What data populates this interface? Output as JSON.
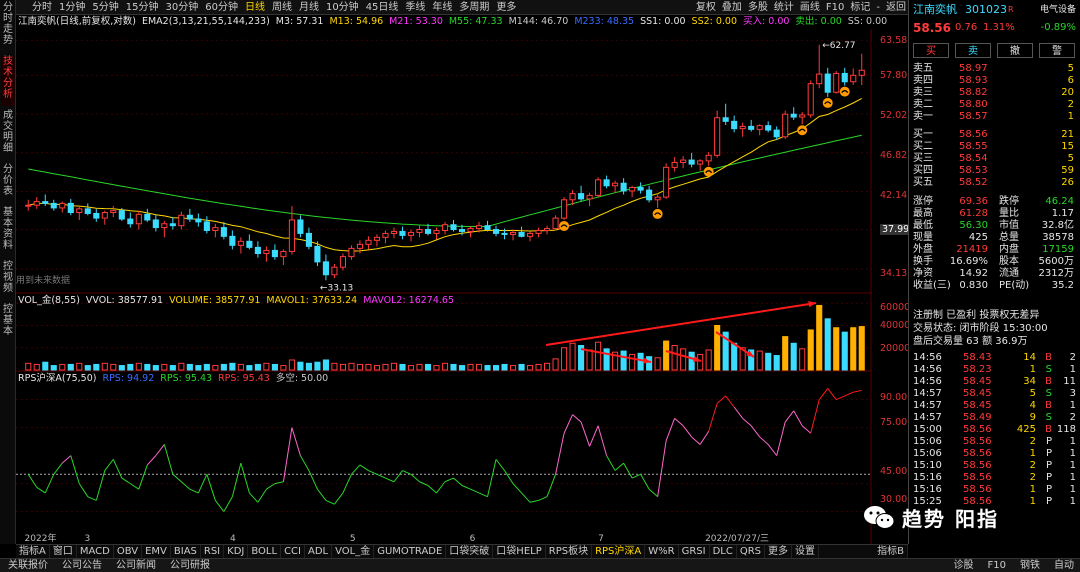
{
  "left_tabs": [
    "分时走势",
    "技术分析",
    "成交明细",
    "分价表",
    "基本资料",
    "控视频",
    "控基本"
  ],
  "period_tabs": [
    "分时",
    "1分钟",
    "5分钟",
    "15分钟",
    "30分钟",
    "60分钟",
    "日线",
    "周线",
    "月线",
    "10分钟",
    "45日线",
    "季线",
    "年线",
    "多周期",
    "更多"
  ],
  "period_selected": 6,
  "top_right": [
    "复权",
    "叠加",
    "多股",
    "统计",
    "画线",
    "F10",
    "标记",
    "-",
    "返回"
  ],
  "title_line": {
    "name": "江南奕帆(日线,前复权,对数)",
    "ema": "EMA2(3,13,21,55,144,233)",
    "items": [
      {
        "text": "M3: 57.31",
        "color": "#e6e6e6"
      },
      {
        "text": "M13: 54.96",
        "color": "#ffd800"
      },
      {
        "text": "M21: 53.30",
        "color": "#ff38ff"
      },
      {
        "text": "M55: 47.33",
        "color": "#2ad62a"
      },
      {
        "text": "M144: 46.70",
        "color": "#c8c8c8"
      },
      {
        "text": "M233: 48.35",
        "color": "#3b6bff"
      },
      {
        "text": "SS1: 0.00",
        "color": "#e6e6e6"
      },
      {
        "text": "SS2: 0.00",
        "color": "#ffd800"
      },
      {
        "text": "买入: 0.00",
        "color": "#ff38ff"
      },
      {
        "text": "卖出: 0.00",
        "color": "#2ad62a"
      },
      {
        "text": "SS: 0.00",
        "color": "#c8c8c8"
      }
    ]
  },
  "price_axis": [
    "63.58",
    "57.80",
    "52.02",
    "46.82",
    "42.14",
    "37.99",
    "34.13"
  ],
  "hi_label": "62.77",
  "lo_label": "33.13",
  "note_label": "用到未来数据",
  "vol_line": {
    "name": "VOL_金(8,55)",
    "items": [
      {
        "text": "VVOL: 38577.91",
        "color": "#e6e6e6"
      },
      {
        "text": "VOLUME: 38577.91",
        "color": "#ffd800"
      },
      {
        "text": "MAVOL1: 37633.24",
        "color": "#ffd800"
      },
      {
        "text": "MAVOL2: 16274.65",
        "color": "#ff38ff"
      }
    ]
  },
  "vol_axis": [
    "60000",
    "40000",
    "20000"
  ],
  "rps_line": {
    "name": "RPS沪深A(75,50)",
    "items": [
      {
        "text": "RPS: 94.92",
        "color": "#3b6bff"
      },
      {
        "text": "RPS: 95.43",
        "color": "#2ad62a"
      },
      {
        "text": "RPS: 95.43",
        "color": "#ff3b3b"
      },
      {
        "text": "多空: 50.00",
        "color": "#c8c8c8"
      }
    ]
  },
  "rps_axis": [
    "90.00",
    "75.00",
    "45.00",
    "30.00"
  ],
  "date_labels": [
    {
      "text": "2022年",
      "pos": 0.01
    },
    {
      "text": "3",
      "pos": 0.08
    },
    {
      "text": "4",
      "pos": 0.25
    },
    {
      "text": "5",
      "pos": 0.39
    },
    {
      "text": "6",
      "pos": 0.53
    },
    {
      "text": "7",
      "pos": 0.68
    },
    {
      "text": "2022/07/27/三",
      "pos": 0.805
    }
  ],
  "bottom_tabs": [
    "指标A",
    "窗口",
    "MACD",
    "OBV",
    "EMV",
    "BIAS",
    "RSI",
    "KDJ",
    "BOLL",
    "CCI",
    "ADL",
    "VOL_金",
    "GUMOTRADE",
    "口袋突破",
    "口袋HELP",
    "RPS板块",
    "RPS沪深A",
    "W%R",
    "GRSI",
    "DLC",
    "QRS",
    "更多",
    "设置"
  ],
  "bottom_selected": 16,
  "bottom_right": "指标B",
  "status_items": [
    "关联报价",
    "公司公告",
    "公司新闻",
    "公司研报"
  ],
  "status_right": [
    "诊股",
    "F10",
    "钢铁",
    "自动"
  ],
  "stock": {
    "name": "江南奕帆",
    "code": "301023",
    "sector": "电气设备",
    "price": "58.56",
    "change": "0.76",
    "pct": "1.31%",
    "weibi": "-0.89%"
  },
  "trade_buttons": [
    "买",
    "卖",
    "撤",
    "警"
  ],
  "asks": [
    {
      "label": "卖五",
      "price": "58.97",
      "vol": "5"
    },
    {
      "label": "卖四",
      "price": "58.93",
      "vol": "6"
    },
    {
      "label": "卖三",
      "price": "58.82",
      "vol": "20"
    },
    {
      "label": "卖二",
      "price": "58.80",
      "vol": "2"
    },
    {
      "label": "卖一",
      "price": "58.57",
      "vol": "1"
    }
  ],
  "bids": [
    {
      "label": "买一",
      "price": "58.56",
      "vol": "21"
    },
    {
      "label": "买二",
      "price": "58.55",
      "vol": "15"
    },
    {
      "label": "买三",
      "price": "58.54",
      "vol": "5"
    },
    {
      "label": "买四",
      "price": "58.53",
      "vol": "59"
    },
    {
      "label": "买五",
      "price": "58.52",
      "vol": "26"
    }
  ],
  "stats": [
    [
      "涨停",
      "69.36",
      "跌停",
      "46.24"
    ],
    [
      "最高",
      "61.28",
      "量比",
      "1.17"
    ],
    [
      "最低",
      "56.30",
      "市值",
      "32.8亿"
    ],
    [
      "现量",
      "425",
      "总量",
      "38578"
    ],
    [
      "外盘",
      "21419",
      "内盘",
      "17159"
    ],
    [
      "换手",
      "16.69%",
      "股本",
      "5600万"
    ],
    [
      "净资",
      "14.92",
      "流通",
      "2312万"
    ],
    [
      "收益(三)",
      "0.830",
      "PE(动)",
      "35.2"
    ]
  ],
  "info_lines": [
    "注册制 已盈利 投票权无差异",
    "交易状态: 闭市阶段 15:30:00",
    "盘后交易量 63 额 36.9万"
  ],
  "ticks": [
    [
      "14:56",
      "58.43",
      "14",
      "B",
      "2"
    ],
    [
      "14:56",
      "58.23",
      "1",
      "S",
      "1"
    ],
    [
      "14:56",
      "58.45",
      "34",
      "B",
      "11"
    ],
    [
      "14:57",
      "58.45",
      "5",
      "S",
      "3"
    ],
    [
      "14:57",
      "58.45",
      "4",
      "B",
      "1"
    ],
    [
      "14:57",
      "58.49",
      "9",
      "S",
      "2"
    ],
    [
      "15:00",
      "58.56",
      "425",
      "B",
      "118"
    ],
    [
      "15:06",
      "58.56",
      "2",
      "P",
      "1"
    ],
    [
      "15:06",
      "58.56",
      "1",
      "P",
      "1"
    ],
    [
      "15:10",
      "58.56",
      "2",
      "P",
      "1"
    ],
    [
      "15:16",
      "58.56",
      "2",
      "P",
      "1"
    ],
    [
      "15:16",
      "58.56",
      "1",
      "P",
      "1"
    ],
    [
      "15:25",
      "58.56",
      "1",
      "P",
      "1"
    ]
  ],
  "watermark": "趋势 阳指",
  "chart_data": {
    "type": "candlestick",
    "candles": [
      [
        40.5,
        41.2,
        40.0,
        40.6
      ],
      [
        40.6,
        41.5,
        40.2,
        41.0
      ],
      [
        41.0,
        41.8,
        40.5,
        40.8
      ],
      [
        40.8,
        41.2,
        40.0,
        40.3
      ],
      [
        40.3,
        41.0,
        39.8,
        40.8
      ],
      [
        40.8,
        41.3,
        39.5,
        39.8
      ],
      [
        39.8,
        40.5,
        39.0,
        40.2
      ],
      [
        40.2,
        40.8,
        39.5,
        39.7
      ],
      [
        39.7,
        40.2,
        38.8,
        39.2
      ],
      [
        39.2,
        40.0,
        38.5,
        39.8
      ],
      [
        39.8,
        40.5,
        39.3,
        40.0
      ],
      [
        40.0,
        40.3,
        38.9,
        39.1
      ],
      [
        39.1,
        39.8,
        38.2,
        38.6
      ],
      [
        38.6,
        40.0,
        38.0,
        39.6
      ],
      [
        39.6,
        40.2,
        38.8,
        39.0
      ],
      [
        39.0,
        39.6,
        37.8,
        38.2
      ],
      [
        38.2,
        38.9,
        37.2,
        38.6
      ],
      [
        38.6,
        39.3,
        38.0,
        38.4
      ],
      [
        38.4,
        39.9,
        38.0,
        39.5
      ],
      [
        39.5,
        40.2,
        38.8,
        39.1
      ],
      [
        39.1,
        39.7,
        38.3,
        38.8
      ],
      [
        38.8,
        39.4,
        37.6,
        37.9
      ],
      [
        37.9,
        38.6,
        37.2,
        38.2
      ],
      [
        38.2,
        38.8,
        37.0,
        37.3
      ],
      [
        37.3,
        37.9,
        36.0,
        36.4
      ],
      [
        36.4,
        37.2,
        35.6,
        36.8
      ],
      [
        36.8,
        37.5,
        36.0,
        36.2
      ],
      [
        36.2,
        36.8,
        35.2,
        35.6
      ],
      [
        35.6,
        36.3,
        34.8,
        35.9
      ],
      [
        35.9,
        36.5,
        35.0,
        35.3
      ],
      [
        35.3,
        36.0,
        34.5,
        35.8
      ],
      [
        35.8,
        40.5,
        35.5,
        39.0
      ],
      [
        39.0,
        39.5,
        37.2,
        37.6
      ],
      [
        37.6,
        38.2,
        36.0,
        36.3
      ],
      [
        36.3,
        36.8,
        34.4,
        34.8
      ],
      [
        34.8,
        35.5,
        33.1,
        33.6
      ],
      [
        33.6,
        34.6,
        33.3,
        34.3
      ],
      [
        34.3,
        35.6,
        34.0,
        35.3
      ],
      [
        35.3,
        36.4,
        35.0,
        36.1
      ],
      [
        36.1,
        36.9,
        35.6,
        36.5
      ],
      [
        36.5,
        37.3,
        36.0,
        36.9
      ],
      [
        36.9,
        37.5,
        36.3,
        37.2
      ],
      [
        37.2,
        37.9,
        36.6,
        37.6
      ],
      [
        37.6,
        38.2,
        37.1,
        37.8
      ],
      [
        37.8,
        38.3,
        37.0,
        37.4
      ],
      [
        37.4,
        38.0,
        36.8,
        37.7
      ],
      [
        37.7,
        38.4,
        37.2,
        38.0
      ],
      [
        38.0,
        38.6,
        37.4,
        37.6
      ],
      [
        37.6,
        38.2,
        37.0,
        37.9
      ],
      [
        37.9,
        38.8,
        37.5,
        38.5
      ],
      [
        38.5,
        39.0,
        37.8,
        38.0
      ],
      [
        38.0,
        38.5,
        37.4,
        37.8
      ],
      [
        37.8,
        38.3,
        37.2,
        38.1
      ],
      [
        38.1,
        38.8,
        37.7,
        38.4
      ],
      [
        38.4,
        38.9,
        37.8,
        38.0
      ],
      [
        38.0,
        38.4,
        37.3,
        37.6
      ],
      [
        37.6,
        38.1,
        37.0,
        37.5
      ],
      [
        37.5,
        38.0,
        36.9,
        37.7
      ],
      [
        37.7,
        38.3,
        37.2,
        37.3
      ],
      [
        37.3,
        37.8,
        36.8,
        37.6
      ],
      [
        37.6,
        38.2,
        37.2,
        37.9
      ],
      [
        37.9,
        38.4,
        37.5,
        38.1
      ],
      [
        38.1,
        39.5,
        37.9,
        39.2
      ],
      [
        39.2,
        41.5,
        39.0,
        41.2
      ],
      [
        41.2,
        42.3,
        40.6,
        41.9
      ],
      [
        41.9,
        42.8,
        41.0,
        41.3
      ],
      [
        41.3,
        42.0,
        40.5,
        41.7
      ],
      [
        41.7,
        43.8,
        41.5,
        43.5
      ],
      [
        43.5,
        44.0,
        42.5,
        42.8
      ],
      [
        42.8,
        43.4,
        42.0,
        43.1
      ],
      [
        43.1,
        43.7,
        41.8,
        42.2
      ],
      [
        42.2,
        42.8,
        41.5,
        42.6
      ],
      [
        42.6,
        43.2,
        41.9,
        42.3
      ],
      [
        42.3,
        42.8,
        40.9,
        41.2
      ],
      [
        41.2,
        41.9,
        40.3,
        41.5
      ],
      [
        41.5,
        45.5,
        41.3,
        45.0
      ],
      [
        45.0,
        46.3,
        44.5,
        45.6
      ],
      [
        45.6,
        46.4,
        44.9,
        45.9
      ],
      [
        45.9,
        46.8,
        45.0,
        45.4
      ],
      [
        45.4,
        46.0,
        44.6,
        45.8
      ],
      [
        45.8,
        46.9,
        45.2,
        46.5
      ],
      [
        46.5,
        52.5,
        46.2,
        51.5
      ],
      [
        51.5,
        53.5,
        50.5,
        51.0
      ],
      [
        51.0,
        51.8,
        49.5,
        50.0
      ],
      [
        50.0,
        50.8,
        48.9,
        50.3
      ],
      [
        50.3,
        51.2,
        49.6,
        49.9
      ],
      [
        49.9,
        50.6,
        49.1,
        50.4
      ],
      [
        50.4,
        51.0,
        49.5,
        49.8
      ],
      [
        49.8,
        50.3,
        48.5,
        48.9
      ],
      [
        48.9,
        52.5,
        48.6,
        52.0
      ],
      [
        52.0,
        53.0,
        51.2,
        51.6
      ],
      [
        51.6,
        52.3,
        50.6,
        51.9
      ],
      [
        51.9,
        57.0,
        51.5,
        56.5
      ],
      [
        56.5,
        62.8,
        55.8,
        58.0
      ],
      [
        58.0,
        59.0,
        54.5,
        55.2
      ],
      [
        55.2,
        58.5,
        55.0,
        58.1
      ],
      [
        58.1,
        59.0,
        56.2,
        56.8
      ],
      [
        56.8,
        58.9,
        56.3,
        57.8
      ],
      [
        57.8,
        61.3,
        56.3,
        58.6
      ]
    ],
    "volume": [
      6,
      5,
      7,
      4,
      5,
      5,
      6,
      4,
      5,
      6,
      5,
      4,
      5,
      6,
      5,
      4,
      5,
      4,
      6,
      5,
      4,
      5,
      4,
      5,
      6,
      5,
      4,
      5,
      6,
      5,
      4,
      9,
      7,
      6,
      7,
      9,
      6,
      5,
      6,
      5,
      5,
      4,
      5,
      6,
      5,
      4,
      5,
      5,
      4,
      6,
      5,
      4,
      5,
      5,
      4,
      4,
      5,
      4,
      5,
      4,
      5,
      6,
      10,
      20,
      24,
      22,
      18,
      25,
      19,
      16,
      17,
      14,
      15,
      12,
      11,
      26,
      22,
      19,
      16,
      14,
      18,
      40,
      34,
      24,
      20,
      18,
      17,
      15,
      13,
      30,
      24,
      19,
      36,
      58,
      46,
      38,
      34,
      38,
      39
    ],
    "rps": [
      50,
      43,
      40,
      50,
      56,
      60,
      45,
      38,
      36,
      52,
      58,
      48,
      45,
      42,
      55,
      60,
      66,
      50,
      46,
      42,
      40,
      50,
      36,
      30,
      38,
      56,
      40,
      35,
      42,
      45,
      46,
      75,
      60,
      52,
      42,
      36,
      34,
      40,
      50,
      55,
      52,
      50,
      48,
      46,
      52,
      50,
      46,
      44,
      40,
      46,
      48,
      44,
      42,
      40,
      38,
      58,
      52,
      45,
      40,
      35,
      36,
      38,
      50,
      72,
      82,
      78,
      65,
      76,
      60,
      52,
      56,
      48,
      50,
      42,
      38,
      68,
      80,
      76,
      70,
      66,
      73,
      88,
      92,
      86,
      80,
      76,
      70,
      66,
      60,
      78,
      84,
      76,
      72,
      90,
      96,
      90,
      92,
      94,
      95
    ]
  }
}
